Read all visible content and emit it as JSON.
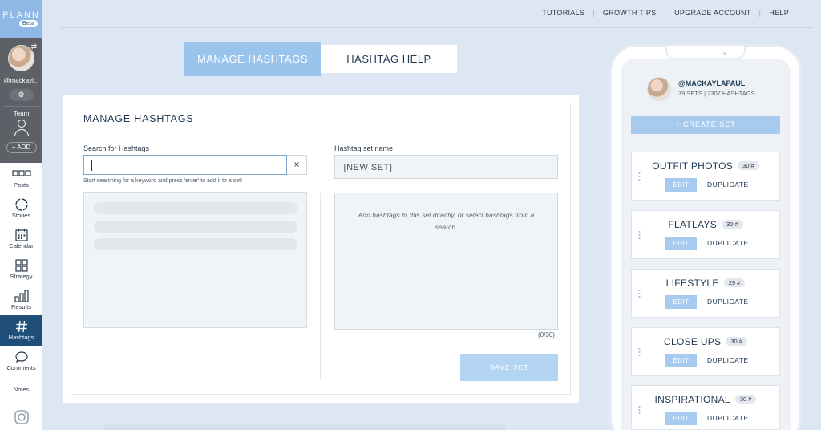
{
  "brand": {
    "logo": "PLANN",
    "beta": "Beta"
  },
  "account": {
    "handle": "@mackayl...",
    "team_label": "Team",
    "add_label": "+ ADD"
  },
  "sidebar": {
    "items": [
      {
        "label": "Posts",
        "icon": "grid-icon"
      },
      {
        "label": "Stories",
        "icon": "stories-ring-icon"
      },
      {
        "label": "Calendar",
        "icon": "calendar-icon"
      },
      {
        "label": "Strategy",
        "icon": "strategy-icon"
      },
      {
        "label": "Results",
        "icon": "bar-chart-icon"
      },
      {
        "label": "Hashtags",
        "icon": "hashtag-icon",
        "active": true
      },
      {
        "label": "Comments",
        "icon": "comment-icon"
      },
      {
        "label": "Notes",
        "icon": "notes-icon"
      }
    ]
  },
  "topnav": {
    "items": [
      "TUTORIALS",
      "GROWTH TIPS",
      "UPGRADE ACCOUNT",
      "HELP"
    ]
  },
  "tabs": {
    "manage": "MANAGE HASHTAGS",
    "help": "HASHTAG HELP"
  },
  "panel": {
    "title": "MANAGE HASHTAGS",
    "search_label": "Search for Hashtags",
    "search_value": "",
    "clear_icon": "×",
    "hint": "Start searching for a keyword and press 'enter' to add it to a set!",
    "set_name_label": "Hashtag set name",
    "set_name_value": "{NEW SET}",
    "set_placeholder": "Add hashtags to this set directly, or select hashtags from a search.",
    "count": "(0/30)",
    "save_label": "SAVE SET"
  },
  "phone": {
    "handle": "@MACKAYLAPAUL",
    "stats": "79 SETS  |  2307 HASHTAGS",
    "create_label": "+ CREATE SET",
    "edit_label": "EDIT",
    "duplicate_label": "DUPLICATE",
    "sets": [
      {
        "name": "OUTFIT PHOTOS",
        "count": "30 #"
      },
      {
        "name": "FLATLAYS",
        "count": "30 #"
      },
      {
        "name": "LIFESTYLE",
        "count": "29 #"
      },
      {
        "name": "CLOSE UPS",
        "count": "30 #"
      },
      {
        "name": "INSPIRATIONAL",
        "count": "30 #"
      }
    ]
  },
  "colors": {
    "accent": "#9bc4ec",
    "active_nav": "#1f4e79",
    "background": "#dde7f3"
  }
}
